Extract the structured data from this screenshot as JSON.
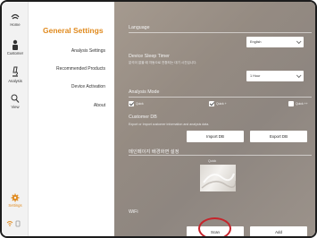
{
  "rail": {
    "home_label": "Home",
    "customer_label": "Customer",
    "analysis_label": "Analysis",
    "view_label": "View",
    "settings_label": "Settings",
    "accent": "#e08a1e"
  },
  "menu": {
    "title": "General Settings",
    "items": [
      "Analysis Settings",
      "Recommended Products",
      "Device Activation",
      "About"
    ]
  },
  "panel": {
    "language_title": "Language",
    "language_value": "English",
    "sleep_title": "Device Sleep Timer",
    "sleep_desc": "분석이 없을 때 자동으로 전환되는 대기 시간입니다.",
    "sleep_value": "1 Hour",
    "analysis_title": "Analysis Mode",
    "modes": [
      {
        "label": "Quick",
        "checked": true
      },
      {
        "label": "Quick +",
        "checked": true
      },
      {
        "label": "Quick ++",
        "checked": false
      }
    ],
    "db_title": "Customer DB",
    "db_desc": "Export or Import customer information and analysis data.",
    "import_label": "Import DB",
    "export_label": "Export DB",
    "homepage_title": "메인페이지 배경화면 설정",
    "logo_label": "Quick",
    "wifi_title": "WiFi",
    "scan_label": "Scan",
    "add_label": "Add"
  }
}
